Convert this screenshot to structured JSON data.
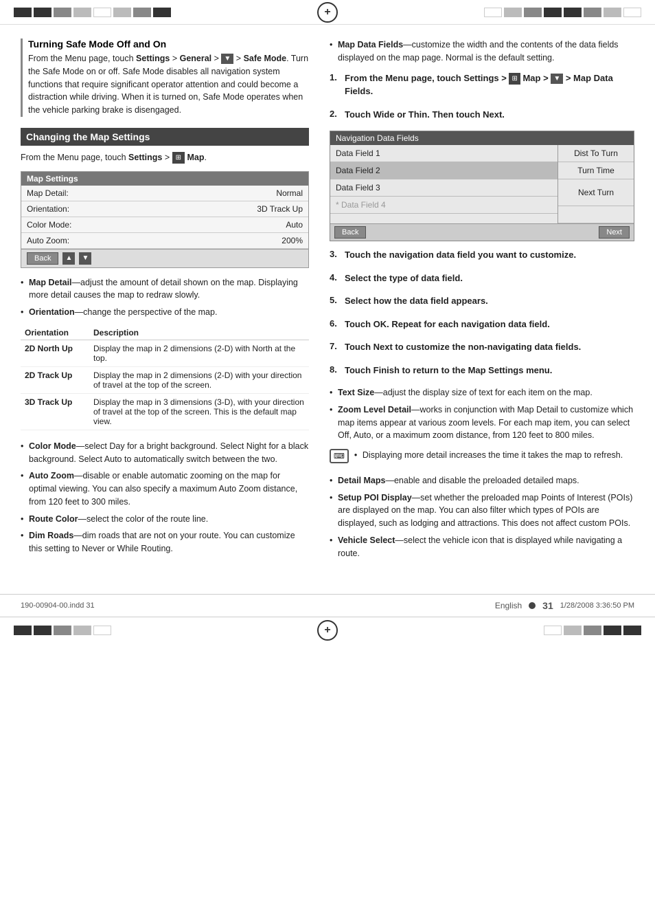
{
  "page": {
    "number": "31",
    "language": "English",
    "footer_left": "190-00904-00.indd   31",
    "footer_right": "1/28/2008   3:36:50 PM"
  },
  "left_column": {
    "section1": {
      "title": "Turning Safe Mode Off and On",
      "body1": "From the Menu page, touch ",
      "body1_bold": "Settings",
      "body2_pre": " > ",
      "body2_bold": "General",
      "body3_pre": " > ",
      "body3_icon": "dropdown",
      "body4_pre": " > ",
      "body4_bold": "Safe Mode",
      "body5": ". Turn the Safe Mode on or off. Safe Mode disables all navigation system functions that require significant operator attention and could become a distraction while driving. When it is turned on, Safe Mode operates when the vehicle parking brake is disengaged."
    },
    "section2": {
      "header": "Changing the Map Settings",
      "intro_pre": "From the Menu page, touch ",
      "intro_bold": "Settings",
      "intro_mid": " > ",
      "intro_icon": "map-icon",
      "intro_end": " Map.",
      "map_settings_box": {
        "header": "Map Settings",
        "rows": [
          {
            "label": "Map Detail:",
            "value": "Normal"
          },
          {
            "label": "Orientation:",
            "value": "3D Track Up"
          },
          {
            "label": "Color Mode:",
            "value": "Auto"
          },
          {
            "label": "Auto Zoom:",
            "value": "200%"
          }
        ],
        "back_btn": "Back"
      },
      "bullets": [
        {
          "bold": "Map Detail",
          "text": "—adjust the amount of detail shown on the map. Displaying more detail causes the map to redraw slowly."
        },
        {
          "bold": "Orientation",
          "text": "—change the perspective of the map."
        }
      ],
      "orientation_table": {
        "headers": [
          "Orientation",
          "Description"
        ],
        "rows": [
          {
            "name": "2D North Up",
            "desc": "Display the map in 2 dimensions (2-D) with North at the top."
          },
          {
            "name": "2D Track Up",
            "desc": "Display the map in 2 dimensions (2-D) with your direction of travel at the top of the screen."
          },
          {
            "name": "3D Track Up",
            "desc": "Display the map in 3 dimensions (3-D), with your direction of travel at the top of the screen. This is the default map view."
          }
        ]
      },
      "more_bullets": [
        {
          "bold": "Color Mode",
          "text": "—select Day for a bright background. Select Night for a black background. Select Auto to automatically switch between the two."
        },
        {
          "bold": "Auto Zoom",
          "text": "—disable or enable automatic zooming on the map for optimal viewing. You can also specify a maximum Auto Zoom distance, from 120 feet to 300 miles."
        },
        {
          "bold": "Route Color",
          "text": "—select the color of the route line."
        },
        {
          "bold": "Dim Roads",
          "text": "—dim roads that are not on your route. You can customize this setting to Never or While Routing."
        }
      ]
    }
  },
  "right_column": {
    "map_data_fields_bullet": {
      "bold": "Map Data Fields",
      "text": "—customize the width and the contents of the data fields displayed on the map page. Normal is the default setting."
    },
    "steps": [
      {
        "num": "1.",
        "text_pre": "From the Menu page, touch ",
        "bold1": "Settings",
        "mid": " > ",
        "icon": "map-icon",
        "bold2": " Map",
        "mid2": " > ",
        "icon2": "dropdown",
        "bold3": " > ",
        "bold3b": "Map Data Fields",
        "end": "."
      },
      {
        "num": "2.",
        "text": "Touch Wide or Thin. Then touch Next."
      }
    ],
    "nav_data_fields_box": {
      "header": "Navigation Data Fields",
      "left_cells": [
        "Data Field 1",
        "Data Field 2",
        "Data Field 3",
        "Data Field 4"
      ],
      "right_cells": [
        "Dist To Turn",
        "Turn Time",
        "Next Turn",
        ""
      ],
      "back_btn": "Back",
      "next_btn": "Next"
    },
    "steps_3_8": [
      {
        "num": "3.",
        "text": "Touch the navigation data field you want to customize."
      },
      {
        "num": "4.",
        "text": "Select the type of data field."
      },
      {
        "num": "5.",
        "text": "Select how the data field appears."
      },
      {
        "num": "6.",
        "text": "Touch OK. Repeat for each navigation data field."
      },
      {
        "num": "7.",
        "text": "Touch Next to customize the non-navigating data fields."
      },
      {
        "num": "8.",
        "text": "Touch Finish to return to the Map Settings menu."
      }
    ],
    "lower_bullets": [
      {
        "bold": "Text Size",
        "text": "—adjust the display size of text for each item on the map."
      },
      {
        "bold": "Zoom Level Detail",
        "text": "—works in conjunction with Map Detail to customize which map items appear at various zoom levels. For each map item, you can select Off, Auto, or a maximum zoom distance, from 120 feet to 800 miles."
      }
    ],
    "note_text": "Displaying more detail increases the time it takes the map to refresh.",
    "final_bullets": [
      {
        "bold": "Detail Maps",
        "text": "—enable and disable the preloaded detailed maps."
      },
      {
        "bold": "Setup POI Display",
        "text": "—set whether the preloaded map Points of Interest (POIs) are displayed on the map. You can also filter which types of POIs are displayed, such as lodging and attractions. This does not affect custom POIs."
      },
      {
        "bold": "Vehicle Select",
        "text": "—select the vehicle icon that is displayed while navigating a route."
      }
    ]
  }
}
